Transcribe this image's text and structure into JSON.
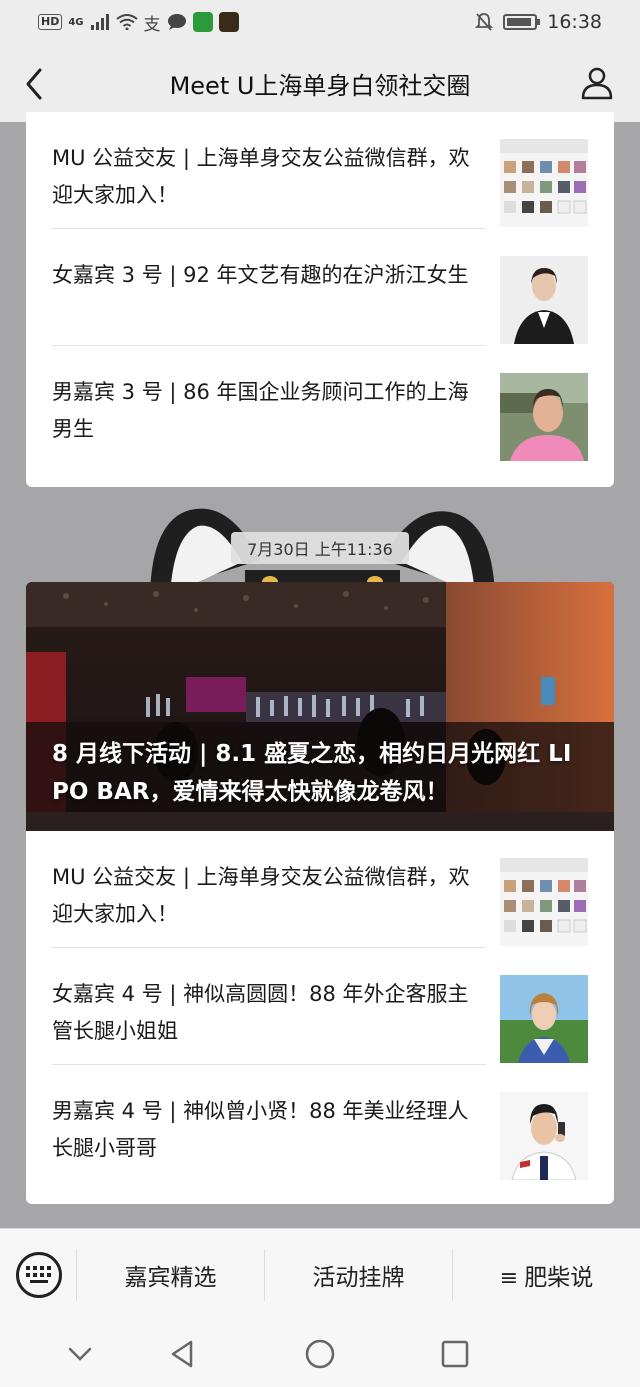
{
  "status_bar": {
    "hd": "HD",
    "network": "4G",
    "time": "16:38"
  },
  "nav": {
    "title": "Meet U上海单身白领社交圈"
  },
  "top_card": {
    "articles": [
      {
        "title": "MU 公益交友 | 上海单身交友公益微信群，欢迎大家加入！",
        "thumb": "group-chat-screenshot"
      },
      {
        "title": "女嘉宾 3 号 | 92 年文艺有趣的在沪浙江女生",
        "thumb": "woman-in-suit-photo"
      },
      {
        "title": "男嘉宾 3 号 | 86 年国企业务顾问工作的上海男生",
        "thumb": "man-pink-shirt-photo"
      }
    ]
  },
  "timestamp": "7月30日 上午11:36",
  "bottom_card": {
    "hero_title": "8 月线下活动 | 8.1 盛夏之恋，相约日月光网红 LI PO BAR，爱情来得太快就像龙卷风！",
    "articles": [
      {
        "title": "MU 公益交友 | 上海单身交友公益微信群，欢迎大家加入！",
        "thumb": "group-chat-screenshot"
      },
      {
        "title": "女嘉宾 4 号 | 神似高圆圆！88 年外企客服主管长腿小姐姐",
        "thumb": "woman-outdoor-photo"
      },
      {
        "title": "男嘉宾 4 号 | 神似曾小贤！88 年美业经理人长腿小哥哥",
        "thumb": "man-on-phone-photo"
      }
    ]
  },
  "menu": {
    "items": [
      {
        "label": "嘉宾精选"
      },
      {
        "label": "活动挂牌"
      },
      {
        "label": "肥柴说",
        "glyph": "≡"
      }
    ]
  },
  "colors": {
    "background": "#a6a6a8",
    "bar": "#ededed",
    "card": "#ffffff"
  }
}
